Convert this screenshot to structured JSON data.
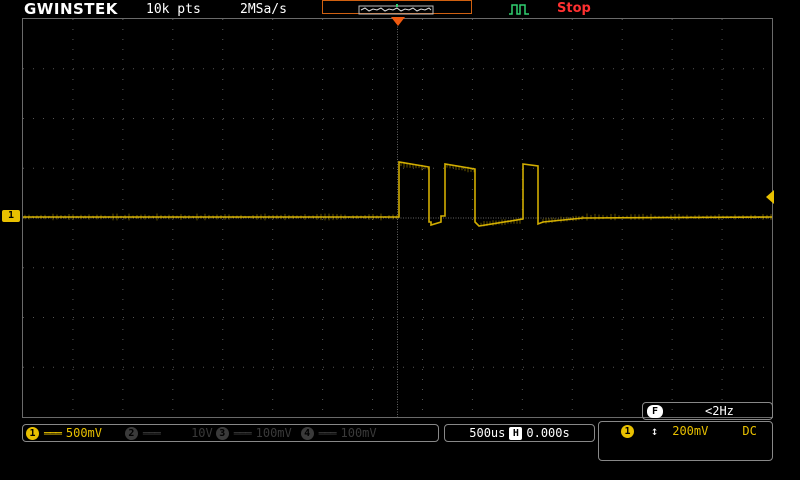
{
  "brand": {
    "logo": "GWINSTEK"
  },
  "acquisition": {
    "record_length": "10k pts",
    "sample_rate": "2MSa/s",
    "run_state": "Stop"
  },
  "colors": {
    "ch1": "#e8c000",
    "ch2": "#3a3a3a",
    "stop": "#ff3030",
    "trigger_icon": "#30d070",
    "trigger_pos": "#f05a10"
  },
  "icons": {
    "trigger_type": "pulse-trigger-icon"
  },
  "channels": [
    {
      "badge": "1",
      "coupling_symbol": "═══",
      "scale": "500mV",
      "active": true
    },
    {
      "badge": "2",
      "coupling_symbol": "═══",
      "scale": "10V",
      "active": false
    },
    {
      "badge": "3",
      "coupling_symbol": "═══",
      "scale": "100mV",
      "active": false
    },
    {
      "badge": "4",
      "coupling_symbol": "═══",
      "scale": "100mV",
      "active": false
    }
  ],
  "ch1_marker": "1",
  "timebase": {
    "scale": "500us",
    "h_badge": "H",
    "delay": "0.000s"
  },
  "frequency": {
    "badge": "F",
    "value": "<2Hz"
  },
  "trigger": {
    "source_badge": "1",
    "slope_symbol": "↕",
    "level": "200mV",
    "coupling": "DC"
  }
}
